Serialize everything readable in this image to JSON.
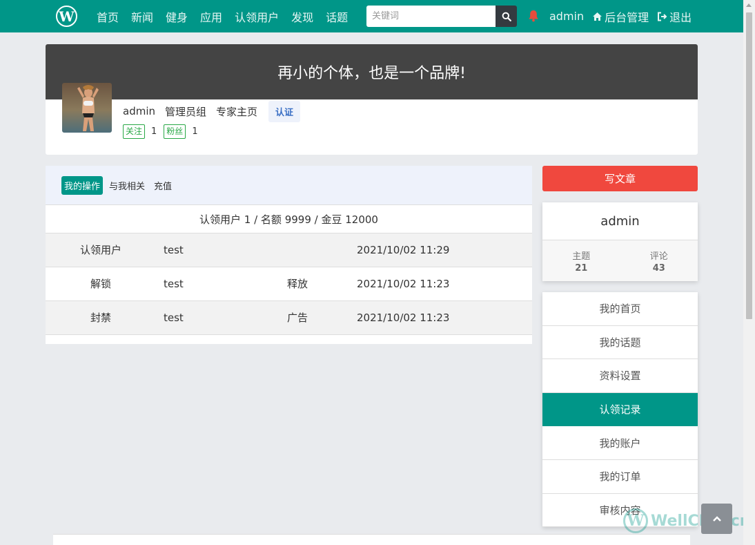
{
  "navbar": {
    "logo_letter": "W",
    "links": [
      "首页",
      "新闻",
      "健身",
      "应用",
      "认领用户",
      "发现",
      "话题"
    ],
    "search_placeholder": "关键词",
    "username": "admin",
    "admin_label": "后台管理",
    "logout_label": "退出",
    "bell_color": "#e74c3c"
  },
  "profile": {
    "banner_text": "再小的个体，也是一个品牌!",
    "name": "admin",
    "group": "管理员组",
    "expert": "专家主页",
    "cert": "认证",
    "follow_label": "关注",
    "follow_count": "1",
    "fans_label": "粉丝",
    "fans_count": "1"
  },
  "tabs": [
    "我的操作",
    "与我相关",
    "充值"
  ],
  "summary": "认领用户 1 / 名额 9999 / 金豆 12000",
  "records": [
    {
      "action": "认领用户",
      "user": "test",
      "note": "",
      "time": "2021/10/02 11:29"
    },
    {
      "action": "解锁",
      "user": "test",
      "note": "释放",
      "time": "2021/10/02 11:23"
    },
    {
      "action": "封禁",
      "user": "test",
      "note": "广告",
      "time": "2021/10/02 11:23"
    }
  ],
  "sidebar": {
    "write_label": "写文章",
    "username": "admin",
    "topics_label": "主题",
    "topics_count": "21",
    "comments_label": "评论",
    "comments_count": "43",
    "menu": [
      "我的首页",
      "我的话题",
      "资料设置",
      "认领记录",
      "我的账户",
      "我的订单",
      "审核内容"
    ],
    "active_menu": "认领记录"
  },
  "watermark": {
    "letter": "W",
    "text": "WellCMS.cn"
  },
  "colors": {
    "primary": "#009688",
    "danger": "#f0483e",
    "banner": "#444444"
  }
}
